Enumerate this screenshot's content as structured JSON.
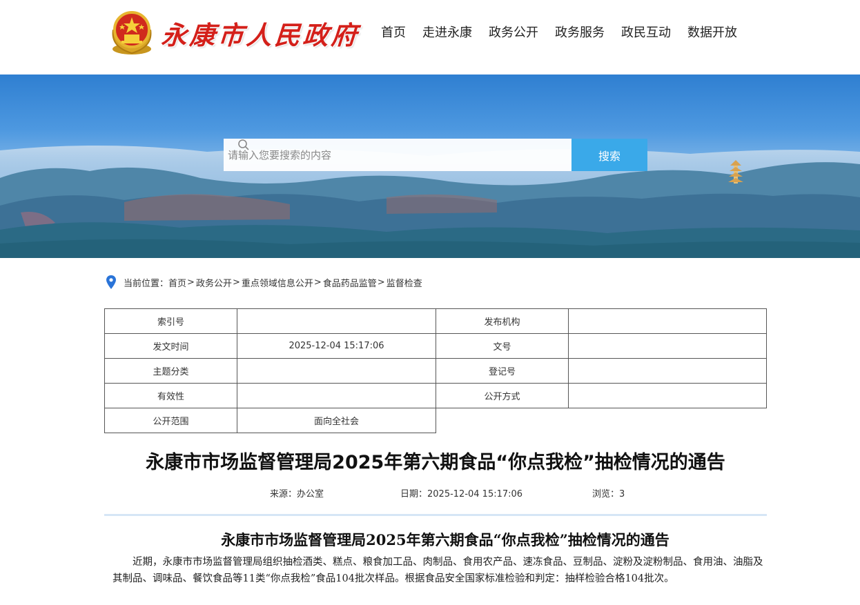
{
  "header": {
    "site_title": "永康市人民政府",
    "nav": [
      "首页",
      "走进永康",
      "政务公开",
      "政务服务",
      "政民互动",
      "数据开放"
    ]
  },
  "banner": {
    "search_placeholder": "请输入您要搜索的内容",
    "search_button": "搜索"
  },
  "breadcrumb": {
    "label": "当前位置：",
    "items": [
      "首页",
      "政务公开",
      "重点领域信息公开",
      "食品药品监管",
      "监督检查"
    ]
  },
  "meta_table": {
    "index_no_label": "索引号",
    "index_no": "",
    "publisher_label": "发布机构",
    "publisher": "",
    "date_label": "发文时间",
    "date": "2025-12-04 15:17:06",
    "doc_no_label": "文号",
    "doc_no": "",
    "topic_label": "主题分类",
    "topic": "",
    "reg_no_label": "登记号",
    "reg_no": "",
    "validity_label": "有效性",
    "validity": "",
    "open_method_label": "公开方式",
    "open_method": "",
    "scope_label": "公开范围",
    "scope": "面向全社会"
  },
  "article": {
    "title": "永康市市场监督管理局2025年第六期食品“你点我检”抽检情况的通告",
    "source": "来源：办公室",
    "date": "日期：2025-12-04 15:17:06",
    "views": "浏览：3",
    "body_title": "永康市市场监督管理局2025年第六期食品“你点我检”抽检情况的通告",
    "body_text": "近期，永康市市场监督管理局组织抽检酒类、糕点、粮食加工品、肉制品、食用农产品、速冻食品、豆制品、淀粉及淀粉制品、食用油、油脂及其制品、调味品、餐饮食品等11类“你点我检”食品104批次样品。根据食品安全国家标准检验和判定：抽样检验合格104批次。"
  },
  "colors": {
    "brand_red": "#d4201a",
    "search_button": "#3aa9e9",
    "pin_blue": "#2a74d8"
  },
  "icons": {
    "logo": "national-emblem-icon",
    "search": "search-icon",
    "breadcrumb": "location-pin-icon"
  }
}
